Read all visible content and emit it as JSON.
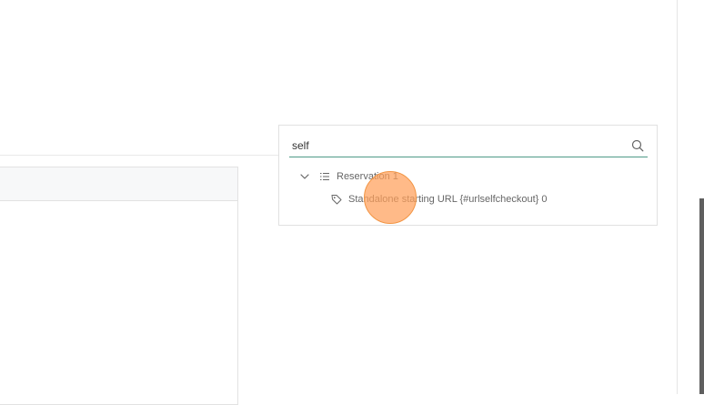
{
  "search": {
    "value": "self"
  },
  "tree": {
    "parent": {
      "label": "Reservation 1",
      "icon": "list-icon",
      "toggle_icon": "chevron-down-icon"
    },
    "child": {
      "label": "Standalone starting URL {#urlselfcheckout} 0",
      "icon": "tag-icon"
    }
  },
  "colors": {
    "accent": "#4f9a88",
    "click_marker": "#f7a565"
  }
}
